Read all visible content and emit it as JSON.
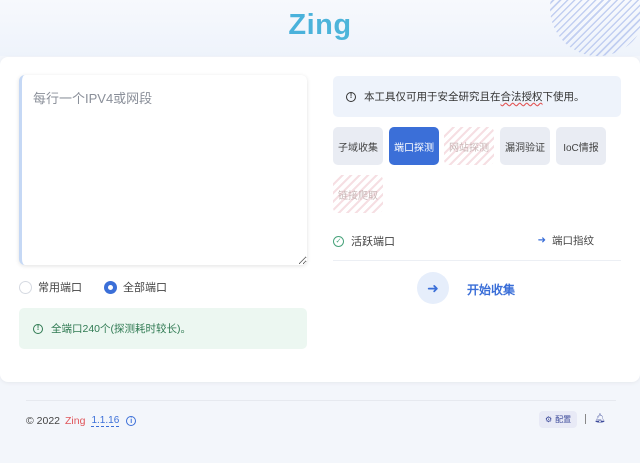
{
  "header": {
    "logo": "Zing"
  },
  "input": {
    "placeholder": "每行一个IPV4或网段"
  },
  "ports": {
    "options": [
      {
        "label": "常用端口",
        "selected": false
      },
      {
        "label": "全部端口",
        "selected": true
      }
    ],
    "note": "全端口240个(探测耗时较长)。"
  },
  "notice": {
    "prefix": "本工具仅可用于安全研究且在",
    "highlight": "合法授权",
    "suffix": "下使用。"
  },
  "modules": [
    {
      "label": "子域收集",
      "state": "normal"
    },
    {
      "label": "端口探测",
      "state": "active"
    },
    {
      "label": "网站探测",
      "state": "disabled"
    },
    {
      "label": "漏洞验证",
      "state": "normal"
    },
    {
      "label": "IoC情报",
      "state": "normal"
    },
    {
      "label": "链接爬取",
      "state": "disabled"
    }
  ],
  "options_row": {
    "check_label": "活跃端口",
    "fingerprint_label": "端口指纹"
  },
  "actions": {
    "start_label": "开始收集"
  },
  "footer": {
    "copyright": "© 2022",
    "brand": "Zing",
    "version": "1.1.16",
    "config_label": "配置"
  },
  "colors": {
    "primary": "#3b6fd8",
    "success_bg": "#ecf7f1",
    "brand_red": "#e0555a"
  }
}
